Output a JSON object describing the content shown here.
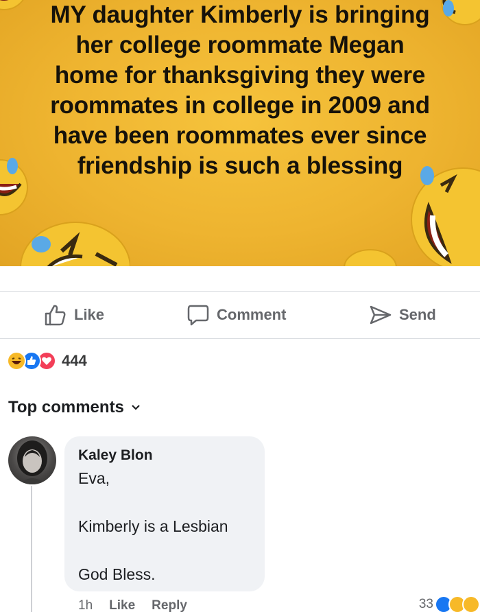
{
  "post": {
    "text_lines": [
      "MY daughter Kimberly is bringing",
      "her college roommate Megan",
      "home for thanksgiving they were",
      "roommates in college in 2009 and",
      "have been roommates ever since",
      "friendship is such a blessing"
    ],
    "background_color": "#eeb430",
    "decor_icon": "laughing-tears-emoji"
  },
  "actions": {
    "like_label": "Like",
    "comment_label": "Comment",
    "send_label": "Send"
  },
  "reactions": {
    "icons": [
      "haha",
      "like",
      "love"
    ],
    "count": "444"
  },
  "comments_section": {
    "sort_label": "Top comments"
  },
  "comment": {
    "author": "Kaley Blon",
    "line1": "Eva,",
    "line2": "Kimberly is a Lesbian",
    "line3": "God Bless.",
    "time": "1h",
    "like_label": "Like",
    "reply_label": "Reply",
    "reaction_count": "33"
  },
  "colors": {
    "like_blue": "#1877f2",
    "love_red": "#f33e58",
    "haha_yellow": "#f7b928",
    "muted_text": "#65676b"
  }
}
